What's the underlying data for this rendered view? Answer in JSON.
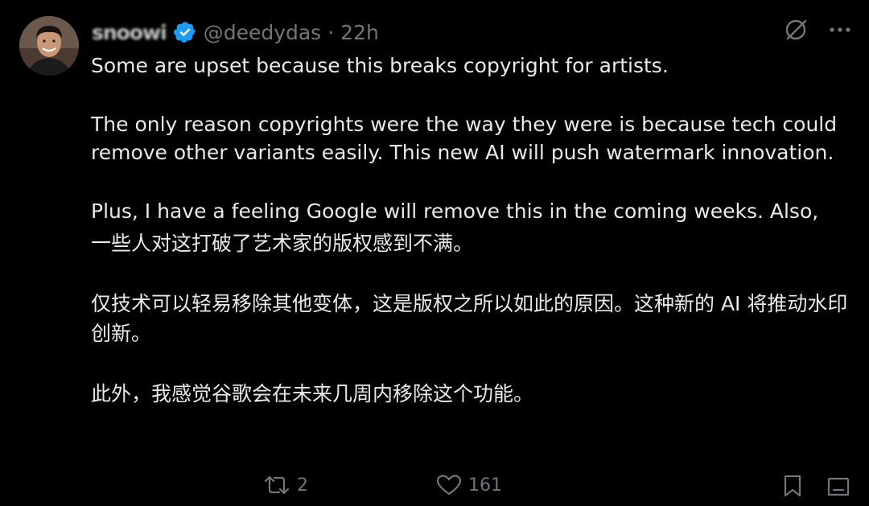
{
  "tweet": {
    "display_name": "snoowi",
    "handle": "@deedydas",
    "separator": "·",
    "time": "22h",
    "paragraphs_en": [
      "Some are upset because this breaks copyright for artists.",
      "The only reason copyrights were the way they were is because tech could remove other variants easily. This new AI will push watermark innovation.",
      "Plus, I have a feeling Google will remove this in the coming weeks. Also,"
    ],
    "paragraphs_zh": [
      "一些人对这打破了艺术家的版权感到不满。",
      "仅技术可以轻易移除其他变体，这是版权之所以如此的原因。这种新的 AI 将推动水印创新。",
      "此外，我感觉谷歌会在未来几周内移除这个功能。"
    ]
  },
  "actions": {
    "retweet_count": "2",
    "like_count": "161"
  },
  "icons": {
    "verified": "verified-badge-icon",
    "grok": "grok-icon",
    "more": "more-icon",
    "retweet": "retweet-icon",
    "like": "heart-icon",
    "bookmark": "bookmark-icon",
    "share": "share-icon"
  },
  "colors": {
    "background": "#000000",
    "text": "#e7e9ea",
    "muted": "#71767b",
    "verified": "#1d9bf0"
  }
}
